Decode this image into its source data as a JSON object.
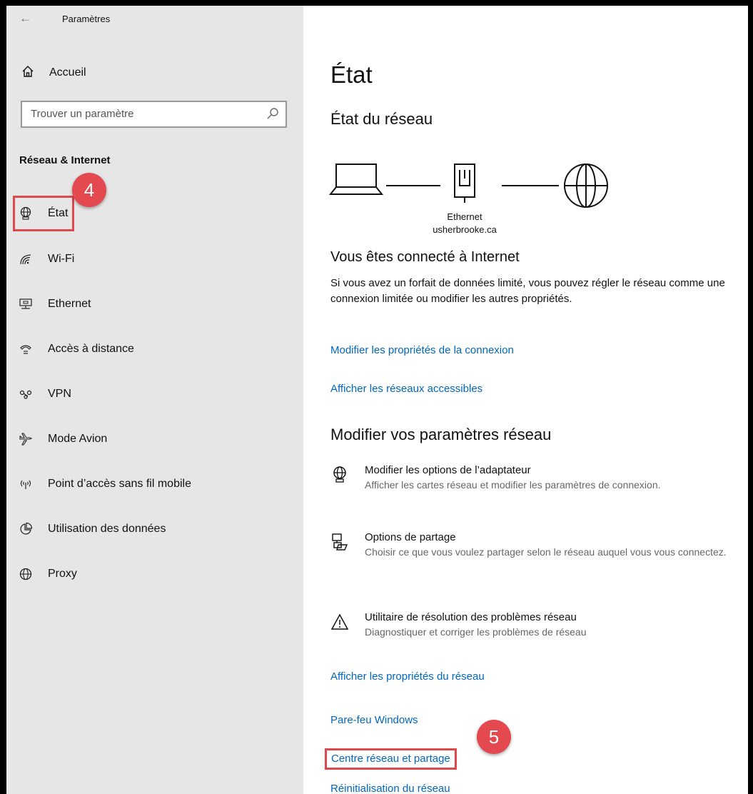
{
  "window": {
    "title": "Paramètres"
  },
  "sidebar": {
    "home_label": "Accueil",
    "search_placeholder": "Trouver un paramètre",
    "section_title": "Réseau & Internet",
    "items": [
      {
        "label": "État",
        "icon": "globe-monitor-icon",
        "selected": true
      },
      {
        "label": "Wi-Fi",
        "icon": "wifi-icon"
      },
      {
        "label": "Ethernet",
        "icon": "ethernet-icon"
      },
      {
        "label": "Accès à distance",
        "icon": "dialup-icon"
      },
      {
        "label": "VPN",
        "icon": "vpn-icon"
      },
      {
        "label": "Mode Avion",
        "icon": "airplane-icon"
      },
      {
        "label": "Point d’accès sans fil mobile",
        "icon": "hotspot-icon"
      },
      {
        "label": "Utilisation des données",
        "icon": "data-usage-icon"
      },
      {
        "label": "Proxy",
        "icon": "globe-icon"
      }
    ]
  },
  "annotations": {
    "step4": "4",
    "step5": "5",
    "color": "#e3494e"
  },
  "main": {
    "title": "État",
    "network_status_title": "État du réseau",
    "diagram": {
      "connection_name": "Ethernet",
      "domain": "usherbrooke.ca"
    },
    "status_head": "Vous êtes connecté à Internet",
    "status_text": "Si vous avez un forfait de données limité, vous pouvez régler le réseau comme une connexion limitée ou modifier les autres propriétés.",
    "link_modify_connection": "Modifier les propriétés de la connexion",
    "link_show_networks": "Afficher les réseaux accessibles",
    "settings_title": "Modifier vos paramètres réseau",
    "options": [
      {
        "title": "Modifier les options de l’adaptateur",
        "desc": "Afficher les cartes réseau et modifier les paramètres de connexion.",
        "icon": "adapter-icon"
      },
      {
        "title": "Options de partage",
        "desc": "Choisir ce que vous voulez partager selon le réseau auquel vous vous connectez.",
        "icon": "sharing-icon"
      },
      {
        "title": "Utilitaire de résolution des problèmes réseau",
        "desc": "Diagnostiquer et corriger les problèmes de réseau",
        "icon": "warning-icon"
      }
    ],
    "link_network_properties": "Afficher les propriétés du réseau",
    "link_firewall": "Pare-feu Windows",
    "link_network_center": "Centre réseau et partage",
    "link_reset": "Réinitialisation du réseau",
    "accent_color": "#0067c0"
  }
}
